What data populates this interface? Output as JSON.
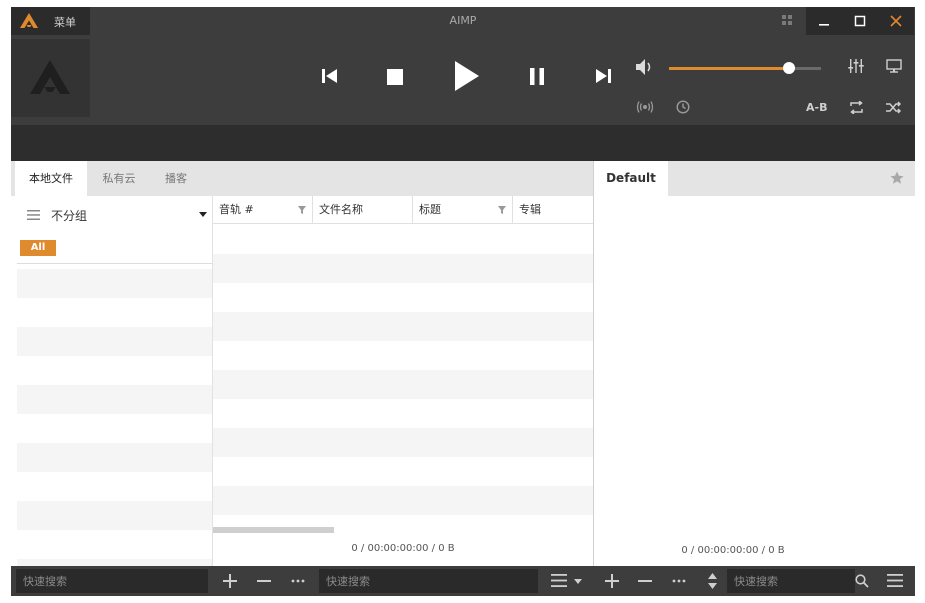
{
  "title_bar": {
    "menu_label": "菜单",
    "app_title": "AIMP"
  },
  "player": {
    "volume_percent": 79,
    "ab_label": "A-B"
  },
  "library": {
    "tabs": [
      {
        "label": "本地文件",
        "active": true
      },
      {
        "label": "私有云",
        "active": false
      },
      {
        "label": "播客",
        "active": false
      }
    ],
    "group_label": "不分组",
    "all_badge": "All",
    "columns": [
      "音轨 #",
      "文件名称",
      "标题",
      "专辑"
    ],
    "status": "0 / 00:00:00:00 / 0 B"
  },
  "playlist": {
    "tab_label": "Default",
    "status": "0 / 00:00:00:00 / 0 B"
  },
  "bottom_bar": {
    "library_search_placeholder": "快速搜索",
    "playlist_search_placeholder": "快速搜索",
    "playlist_search2_placeholder": "快速搜索"
  },
  "colors": {
    "accent": "#e08a2e",
    "dark": "#3d3d3d",
    "darker": "#2b2b2b"
  }
}
